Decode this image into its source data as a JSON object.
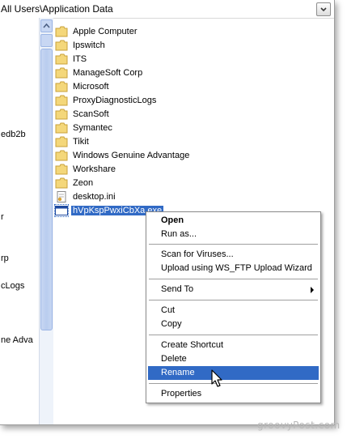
{
  "address_bar": {
    "path": "All Users\\Application Data"
  },
  "left_pane": {
    "items": [
      "edb2b",
      "r",
      "rp",
      "cLogs",
      "ne Adva"
    ]
  },
  "files": [
    {
      "name": "Apple Computer",
      "type": "folder"
    },
    {
      "name": "Ipswitch",
      "type": "folder"
    },
    {
      "name": "ITS",
      "type": "folder"
    },
    {
      "name": "ManageSoft Corp",
      "type": "folder"
    },
    {
      "name": "Microsoft",
      "type": "folder"
    },
    {
      "name": "ProxyDiagnosticLogs",
      "type": "folder"
    },
    {
      "name": "ScanSoft",
      "type": "folder"
    },
    {
      "name": "Symantec",
      "type": "folder"
    },
    {
      "name": "Tikit",
      "type": "folder"
    },
    {
      "name": "Windows Genuine Advantage",
      "type": "folder"
    },
    {
      "name": "Workshare",
      "type": "folder"
    },
    {
      "name": "Zeon",
      "type": "folder"
    },
    {
      "name": "desktop.ini",
      "type": "ini-file"
    },
    {
      "name": "hVpKspPwxiCbXa.exe",
      "type": "exe-file",
      "selected": true
    }
  ],
  "context_menu": {
    "open": "Open",
    "run_as": "Run as...",
    "scan": "Scan for Viruses...",
    "upload": "Upload using WS_FTP Upload Wizard",
    "send_to": "Send To",
    "cut": "Cut",
    "copy": "Copy",
    "create_shortcut": "Create Shortcut",
    "delete": "Delete",
    "rename": "Rename",
    "properties": "Properties",
    "highlighted": "Rename"
  },
  "watermark": "groovyPost.com",
  "colors": {
    "selection": "#316ac5",
    "folder": "#f4d77a",
    "scrollbar_thumb": "#c2d3f2"
  }
}
